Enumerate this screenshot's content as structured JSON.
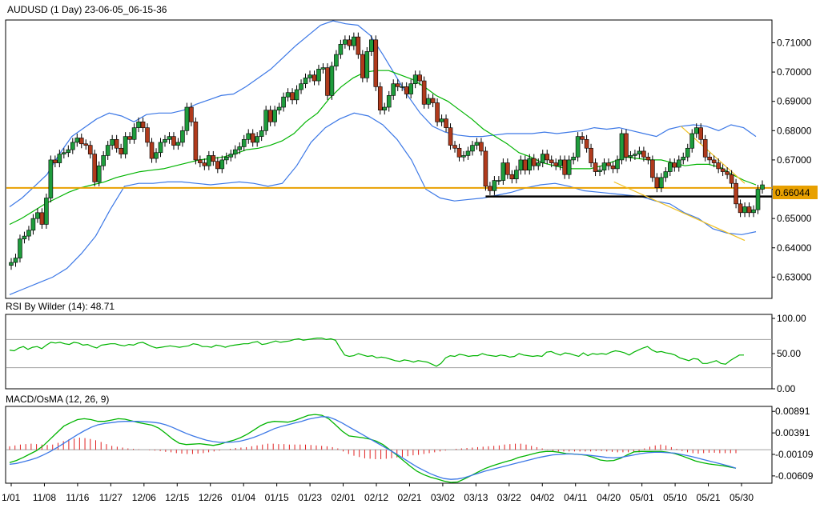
{
  "chart_data": [
    {
      "type": "candlestick",
      "title": "AUDUSD (1 Day) 23-06-05_06-15-36",
      "ylim": [
        0.623,
        0.7175
      ],
      "y_ticks": [
        "0.71000",
        "0.70000",
        "0.69000",
        "0.68000",
        "0.67000",
        "0.66000",
        "0.65000",
        "0.64000",
        "0.63000"
      ],
      "y_tick_values": [
        0.71,
        0.7,
        0.69,
        0.68,
        0.67,
        0.66,
        0.65,
        0.64,
        0.63
      ],
      "last_price_label": "0.66044",
      "last_price": 0.66044,
      "horizontal_lines": [
        {
          "value": 0.66044,
          "color": "#e8a000"
        },
        {
          "value": 0.6575,
          "color": "#000000"
        }
      ],
      "x_ticks": [
        "1/01",
        "11/08",
        "11/16",
        "11/27",
        "12/06",
        "12/15",
        "12/26",
        "01/04",
        "01/15",
        "01/23",
        "02/01",
        "02/12",
        "02/21",
        "03/02",
        "03/13",
        "03/22",
        "04/02",
        "04/11",
        "04/20",
        "05/01",
        "05/10",
        "05/21",
        "05/30"
      ],
      "close": [
        0.635,
        0.6365,
        0.643,
        0.644,
        0.646,
        0.65,
        0.652,
        0.648,
        0.657,
        0.67,
        0.669,
        0.672,
        0.6725,
        0.6735,
        0.676,
        0.6775,
        0.6755,
        0.675,
        0.672,
        0.6625,
        0.668,
        0.6715,
        0.675,
        0.677,
        0.674,
        0.672,
        0.678,
        0.677,
        0.681,
        0.683,
        0.681,
        0.676,
        0.6705,
        0.6725,
        0.676,
        0.677,
        0.678,
        0.675,
        0.676,
        0.68,
        0.688,
        0.683,
        0.67,
        0.669,
        0.668,
        0.6715,
        0.6695,
        0.667,
        0.67,
        0.671,
        0.672,
        0.6735,
        0.6745,
        0.677,
        0.679,
        0.676,
        0.678,
        0.68,
        0.687,
        0.683,
        0.687,
        0.688,
        0.6915,
        0.693,
        0.6905,
        0.694,
        0.696,
        0.698,
        0.699,
        0.697,
        0.701,
        0.7015,
        0.692,
        0.702,
        0.706,
        0.7095,
        0.711,
        0.709,
        0.712,
        0.706,
        0.698,
        0.707,
        0.711,
        0.695,
        0.687,
        0.688,
        0.692,
        0.696,
        0.695,
        0.695,
        0.6925,
        0.696,
        0.699,
        0.697,
        0.689,
        0.691,
        0.6895,
        0.683,
        0.684,
        0.681,
        0.675,
        0.674,
        0.671,
        0.6715,
        0.673,
        0.675,
        0.676,
        0.673,
        0.661,
        0.6595,
        0.663,
        0.663,
        0.669,
        0.665,
        0.6635,
        0.6665,
        0.67,
        0.6665,
        0.6705,
        0.668,
        0.669,
        0.672,
        0.67,
        0.669,
        0.668,
        0.67,
        0.665,
        0.67,
        0.671,
        0.678,
        0.677,
        0.674,
        0.669,
        0.666,
        0.6665,
        0.669,
        0.668,
        0.667,
        0.67,
        0.679,
        0.671,
        0.6715,
        0.672,
        0.673,
        0.671,
        0.67,
        0.664,
        0.6605,
        0.664,
        0.666,
        0.669,
        0.6675,
        0.67,
        0.671,
        0.674,
        0.679,
        0.681,
        0.677,
        0.671,
        0.67,
        0.669,
        0.667,
        0.666,
        0.665,
        0.662,
        0.655,
        0.652,
        0.654,
        0.652,
        0.653,
        0.66,
        0.6615
      ],
      "bollinger": {
        "middle_color": "#00b400",
        "band_color": "#3c78e6",
        "middle": [
          0.648,
          0.65,
          0.6525,
          0.655,
          0.657,
          0.659,
          0.6605,
          0.6615,
          0.6625,
          0.664,
          0.665,
          0.666,
          0.6665,
          0.667,
          0.668,
          0.669,
          0.67,
          0.6705,
          0.671,
          0.672,
          0.6735,
          0.674,
          0.675,
          0.6765,
          0.679,
          0.683,
          0.686,
          0.691,
          0.695,
          0.698,
          0.7,
          0.7005,
          0.7005,
          0.699,
          0.6975,
          0.695,
          0.692,
          0.69,
          0.687,
          0.684,
          0.6805,
          0.678,
          0.6755,
          0.6725,
          0.671,
          0.669,
          0.668,
          0.667,
          0.667,
          0.667,
          0.668,
          0.6695,
          0.671,
          0.6705,
          0.67,
          0.67,
          0.669,
          0.668,
          0.6685,
          0.6685,
          0.6675,
          0.665,
          0.663,
          0.6615
        ],
        "upper": [
          0.654,
          0.657,
          0.661,
          0.665,
          0.672,
          0.678,
          0.681,
          0.684,
          0.686,
          0.685,
          0.683,
          0.6855,
          0.686,
          0.686,
          0.687,
          0.689,
          0.6905,
          0.692,
          0.6925,
          0.695,
          0.698,
          0.701,
          0.705,
          0.709,
          0.7125,
          0.716,
          0.7175,
          0.7165,
          0.716,
          0.7125,
          0.706,
          0.699,
          0.692,
          0.686,
          0.6815,
          0.6795,
          0.6785,
          0.678,
          0.678,
          0.6785,
          0.679,
          0.679,
          0.679,
          0.6795,
          0.679,
          0.6795,
          0.68,
          0.681,
          0.6805,
          0.681,
          0.68,
          0.679,
          0.678,
          0.6805,
          0.6815,
          0.682,
          0.6815,
          0.68,
          0.682,
          0.681,
          0.678
        ],
        "lower": [
          0.624,
          0.626,
          0.628,
          0.63,
          0.633,
          0.638,
          0.644,
          0.653,
          0.661,
          0.662,
          0.662,
          0.6625,
          0.6625,
          0.662,
          0.6615,
          0.662,
          0.6625,
          0.662,
          0.661,
          0.662,
          0.668,
          0.676,
          0.681,
          0.684,
          0.686,
          0.685,
          0.682,
          0.677,
          0.67,
          0.66,
          0.657,
          0.656,
          0.6565,
          0.657,
          0.658,
          0.659,
          0.6605,
          0.6615,
          0.662,
          0.661,
          0.6595,
          0.659,
          0.6585,
          0.658,
          0.6575,
          0.656,
          0.655,
          0.652,
          0.65,
          0.6465,
          0.645,
          0.6445,
          0.6455
        ]
      },
      "channel_lines": [
        {
          "from": [
            "05/10",
            0.6815
          ],
          "to": [
            "06/02",
            0.662
          ],
          "color": "#f0c020"
        },
        {
          "from": [
            "04/20",
            0.6625
          ],
          "to": [
            "06/02",
            0.6425
          ],
          "color": "#f0c020"
        }
      ]
    },
    {
      "type": "line",
      "title": "RSI By Wilder (14): 48.71",
      "ylim": [
        0,
        100
      ],
      "y_ticks": [
        "100.00",
        "50.00",
        "0.00"
      ],
      "y_tick_values": [
        100,
        50,
        0
      ],
      "levels": [
        70,
        30
      ],
      "series": [
        {
          "color": "#00b400",
          "values": [
            55,
            54,
            58,
            60,
            56,
            59,
            60,
            57,
            62,
            66,
            65,
            66,
            64,
            63,
            66,
            65,
            62,
            63,
            60,
            58,
            62,
            63,
            64,
            64,
            62,
            61,
            63,
            62,
            65,
            66,
            63,
            60,
            58,
            59,
            60,
            61,
            60,
            59,
            60,
            61,
            64,
            63,
            60,
            60,
            59,
            62,
            61,
            59,
            61,
            62,
            63,
            64,
            64,
            66,
            67,
            63,
            64,
            66,
            68,
            66,
            67,
            68,
            70,
            71,
            69,
            70,
            71,
            72,
            72,
            70,
            71,
            69,
            58,
            48,
            46,
            47,
            50,
            48,
            46,
            47,
            44,
            45,
            44,
            42,
            40,
            39,
            41,
            40,
            38,
            40,
            39,
            38,
            35,
            32,
            36,
            44,
            47,
            46,
            49,
            48,
            46,
            47,
            47,
            50,
            48,
            47,
            46,
            48,
            47,
            45,
            46,
            50,
            48,
            47,
            46,
            47,
            46,
            52,
            53,
            50,
            48,
            51,
            50,
            48,
            46,
            51,
            47,
            50,
            49,
            50,
            49,
            52,
            54,
            53,
            51,
            48,
            52,
            55,
            58,
            60,
            55,
            52,
            53,
            51,
            50,
            48,
            44,
            42,
            40,
            43,
            42,
            36,
            36,
            38,
            40,
            36,
            35,
            40,
            44,
            48,
            48
          ]
        }
      ]
    },
    {
      "type": "bar",
      "title": "MACD/OsMA (12, 26, 9)",
      "ylim": [
        -0.0076,
        0.0097
      ],
      "y_ticks": [
        "0.00891",
        "0.00391",
        "-0.00109",
        "-0.00609"
      ],
      "y_tick_values": [
        0.00891,
        0.00391,
        -0.00109,
        -0.00609
      ],
      "osma_color": "#e02020",
      "osma": [
        0.0008,
        0.001,
        0.0012,
        0.0013,
        0.0014,
        0.0013,
        0.0012,
        0.0011,
        0.0012,
        0.0016,
        0.002,
        0.0024,
        0.0026,
        0.0028,
        0.0027,
        0.0025,
        0.0022,
        0.0018,
        0.0013,
        0.0009,
        0.0007,
        0.0005,
        0.0003,
        0.0002,
        0.0001,
        0.0,
        -0.0001,
        -0.0002,
        -0.0003,
        -0.0005,
        -0.0006,
        -0.0008,
        -0.0009,
        -0.001,
        -0.001,
        -0.0009,
        -0.0008,
        -0.0006,
        -0.0004,
        -0.0002,
        0.0,
        0.0002,
        0.0004,
        0.0005,
        0.0006,
        0.0008,
        0.001,
        0.0012,
        0.0014,
        0.0014,
        0.0013,
        0.0013,
        0.0012,
        0.0012,
        0.0012,
        0.0012,
        0.0011,
        0.001,
        0.0009,
        0.0008,
        0.0006,
        0.0003,
        -0.0004,
        -0.001,
        -0.0014,
        -0.0017,
        -0.002,
        -0.0021,
        -0.0022,
        -0.0022,
        -0.0021,
        -0.002,
        -0.0018,
        -0.0017,
        -0.0015,
        -0.0013,
        -0.0012,
        -0.001,
        -0.0008,
        -0.0006,
        -0.0004,
        -0.0002,
        0.0,
        0.0002,
        0.0003,
        0.0004,
        0.0005,
        0.0006,
        0.0007,
        0.0008,
        0.0009,
        0.001,
        0.0012,
        0.0013,
        0.0014,
        0.0014,
        0.0012,
        0.0009,
        0.0006,
        0.0003,
        -0.0001,
        -0.0003,
        -0.0004,
        -0.0004,
        -0.0004,
        -0.0004,
        -0.0004,
        -0.0004,
        -0.0004,
        -0.0003,
        -0.0003,
        -0.0004,
        -0.0005,
        -0.0006,
        -0.0006,
        -0.0006,
        -0.0006,
        -0.0006,
        0.0003,
        0.0007,
        0.001,
        0.0012,
        0.001,
        0.0006,
        0.0002,
        -0.0003,
        -0.0006,
        -0.0008,
        -0.0009,
        -0.0008,
        -0.0007,
        -0.0007,
        -0.0008,
        -0.0008,
        -0.0008,
        -0.0008
      ],
      "series": [
        {
          "color": "#00b400",
          "values": [
            -0.003,
            -0.0025,
            -0.0018,
            -0.001,
            -0.0002,
            0.001,
            0.0025,
            0.004,
            0.0055,
            0.0063,
            0.007,
            0.0072,
            0.007,
            0.0066,
            0.0066,
            0.0069,
            0.0072,
            0.0071,
            0.0067,
            0.0063,
            0.006,
            0.0057,
            0.005,
            0.0038,
            0.0025,
            0.0015,
            0.0012,
            0.0013,
            0.0014,
            0.0012,
            0.001,
            0.0013,
            0.0018,
            0.0022,
            0.0028,
            0.0036,
            0.0046,
            0.0056,
            0.0063,
            0.0066,
            0.0065,
            0.0064,
            0.0068,
            0.0074,
            0.008,
            0.0082,
            0.008,
            0.0072,
            0.0058,
            0.0043,
            0.0032,
            0.003,
            0.0028,
            0.0025,
            0.002,
            0.0012,
            0.0,
            -0.0012,
            -0.0025,
            -0.0038,
            -0.005,
            -0.0058,
            -0.0064,
            -0.0068,
            -0.0073,
            -0.0076,
            -0.0075,
            -0.0068,
            -0.006,
            -0.0052,
            -0.0044,
            -0.0038,
            -0.0033,
            -0.0028,
            -0.0024,
            -0.0018,
            -0.0014,
            -0.001,
            -0.0006,
            -0.0004,
            -0.0004,
            -0.0006,
            -0.0009,
            -0.001,
            -0.0011,
            -0.0013,
            -0.0018,
            -0.0024,
            -0.0026,
            -0.0025,
            -0.002,
            -0.0012,
            -0.0005,
            -0.0004,
            -0.0004,
            -0.0004,
            -0.0004,
            -0.0006,
            -0.0009,
            -0.0014,
            -0.002,
            -0.0026,
            -0.003,
            -0.0033,
            -0.0035,
            -0.0037,
            -0.004,
            -0.0043
          ]
        },
        {
          "color": "#3c78e6",
          "values": [
            -0.0034,
            -0.0032,
            -0.0028,
            -0.0024,
            -0.0019,
            -0.0012,
            -0.0004,
            0.0005,
            0.0015,
            0.0025,
            0.0035,
            0.0044,
            0.0052,
            0.0058,
            0.0061,
            0.0063,
            0.0065,
            0.0066,
            0.0066,
            0.0066,
            0.0065,
            0.0064,
            0.0062,
            0.0058,
            0.0052,
            0.0045,
            0.0038,
            0.0032,
            0.0027,
            0.0022,
            0.0019,
            0.0017,
            0.0017,
            0.0018,
            0.002,
            0.0024,
            0.0029,
            0.0035,
            0.0042,
            0.0049,
            0.0054,
            0.0058,
            0.0062,
            0.0066,
            0.0071,
            0.0074,
            0.0077,
            0.0076,
            0.007,
            0.0062,
            0.0053,
            0.0044,
            0.0035,
            0.0026,
            0.0017,
            0.0008,
            -0.0001,
            -0.001,
            -0.002,
            -0.003,
            -0.004,
            -0.0048,
            -0.0056,
            -0.0062,
            -0.0067,
            -0.0069,
            -0.0068,
            -0.0065,
            -0.006,
            -0.0055,
            -0.005,
            -0.0046,
            -0.0042,
            -0.0038,
            -0.0034,
            -0.003,
            -0.0026,
            -0.0022,
            -0.0018,
            -0.0015,
            -0.0012,
            -0.0011,
            -0.001,
            -0.001,
            -0.0011,
            -0.0012,
            -0.0014,
            -0.0016,
            -0.0018,
            -0.0019,
            -0.0018,
            -0.0015,
            -0.0012,
            -0.0009,
            -0.0007,
            -0.0006,
            -0.0006,
            -0.0007,
            -0.0008,
            -0.0011,
            -0.0014,
            -0.0018,
            -0.0022,
            -0.0026,
            -0.003,
            -0.0034,
            -0.0038,
            -0.0043
          ]
        }
      ]
    }
  ]
}
